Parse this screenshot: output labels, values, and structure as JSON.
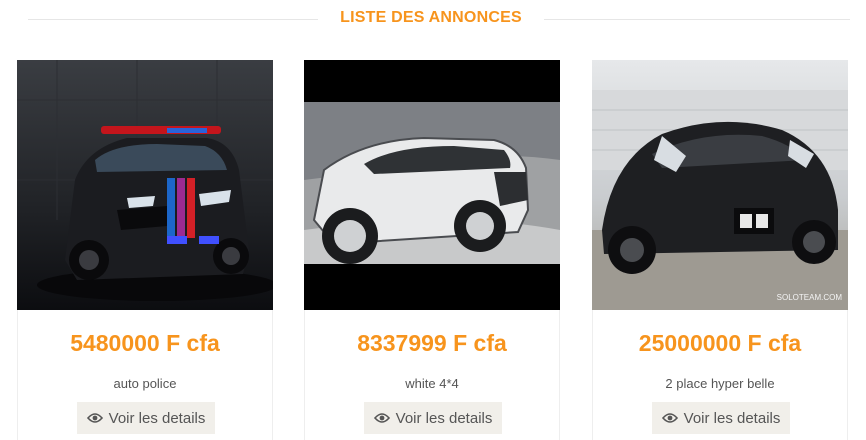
{
  "section": {
    "title": "LISTE DES ANNONCES"
  },
  "listings": [
    {
      "image_alt": "black police car",
      "price": "5480000 F cfa",
      "title": "auto police",
      "details_label": "Voir les details"
    },
    {
      "image_alt": "white SUV",
      "price": "8337999 F cfa",
      "title": "white 4*4",
      "details_label": "Voir les details"
    },
    {
      "image_alt": "black concept car",
      "price": "25000000 F cfa",
      "title": "2 place hyper belle",
      "details_label": "Voir les details",
      "watermark": "SOLOTEAM.COM"
    }
  ],
  "colors": {
    "accent": "#f7941d",
    "button_bg": "#f1efea",
    "text": "#555555"
  },
  "icons": {
    "details": "eye-icon"
  }
}
